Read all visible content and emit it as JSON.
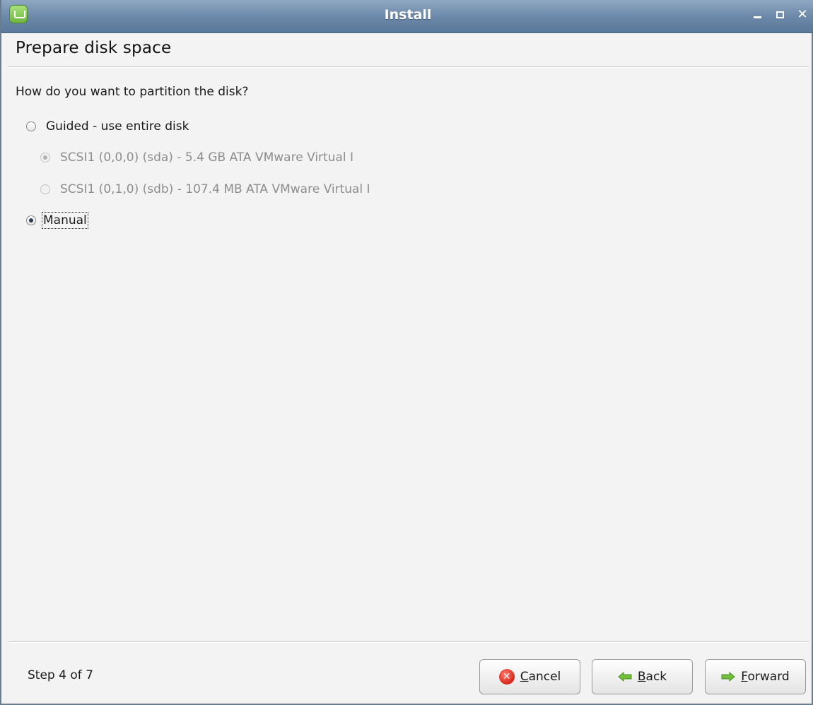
{
  "window": {
    "title": "Install",
    "controls": {
      "minimize": "minimize-icon",
      "maximize": "maximize-icon",
      "close": "close-icon"
    }
  },
  "page": {
    "title": "Prepare disk space",
    "question": "How do you want to partition the disk?"
  },
  "options": {
    "guided": {
      "label": "Guided - use entire disk",
      "selected": false,
      "enabled": true
    },
    "disks": [
      {
        "label": "SCSI1 (0,0,0) (sda) - 5.4 GB ATA VMware Virtual I",
        "selected": true,
        "enabled": false
      },
      {
        "label": "SCSI1 (0,1,0) (sdb) - 107.4 MB ATA VMware Virtual I",
        "selected": false,
        "enabled": false
      }
    ],
    "manual": {
      "label": "Manual",
      "selected": true,
      "enabled": true
    }
  },
  "footer": {
    "step": "Step 4 of 7",
    "cancel": {
      "mnemonic": "C",
      "rest": "ancel"
    },
    "back": {
      "mnemonic": "B",
      "rest": "ack"
    },
    "forward": {
      "mnemonic": "F",
      "rest": "orward"
    }
  },
  "colors": {
    "titlebar": "#6a87a8",
    "background": "#f3f3f3",
    "cancel_icon": "#d6261a",
    "arrow_green": "#6fbf3a"
  }
}
